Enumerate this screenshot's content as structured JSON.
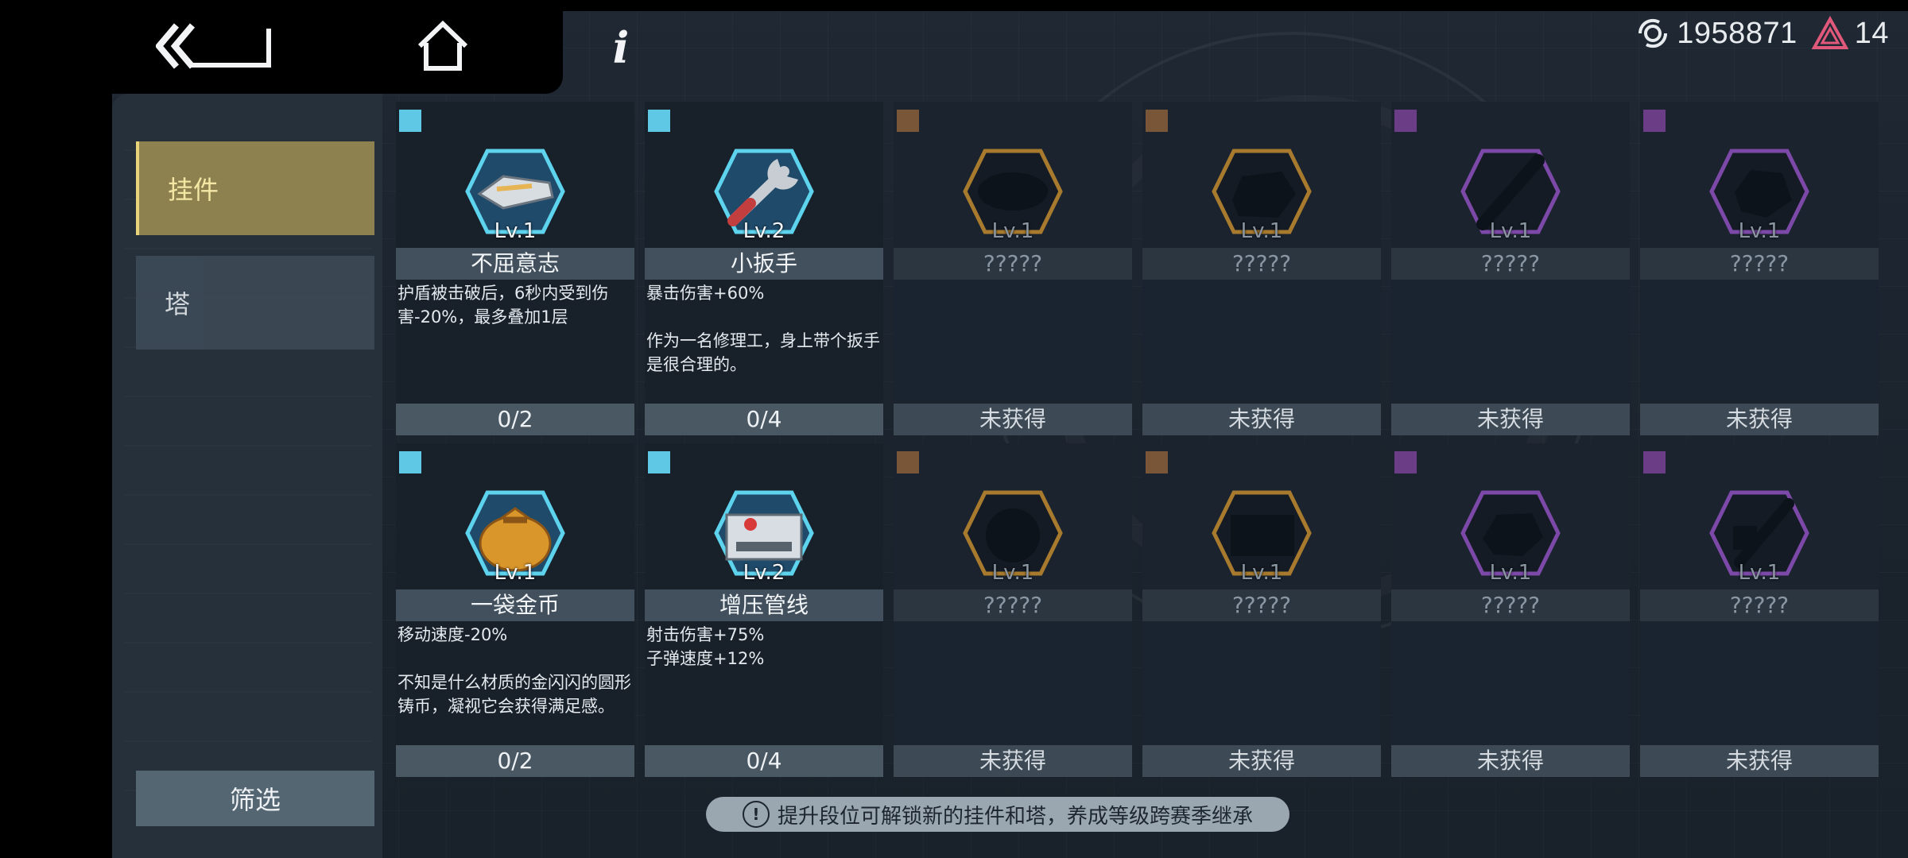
{
  "currency": {
    "credits": "1958871",
    "crystals": "14",
    "credits_icon": "credits-icon",
    "crystal_icon": "crystal-icon"
  },
  "nav": {
    "back_icon": "back-arrow-icon",
    "home_icon": "home-icon",
    "info_icon": "info-icon"
  },
  "sidebar": {
    "tabs": [
      {
        "label": "挂件",
        "active": true
      },
      {
        "label": "塔",
        "active": false
      }
    ],
    "filter_label": "筛选"
  },
  "colors": {
    "rarity_blue": "#5ec8e5",
    "rarity_brown": "#7a5638",
    "rarity_purple": "#6a3d86",
    "active_tab": "#8e8150"
  },
  "items": [
    {
      "level": "Lv.1",
      "name": "不屈意志",
      "desc": "护盾被击破后，6秒内受到伤害-20%，最多叠加1层",
      "count": "0/2",
      "rarity": "blue",
      "icon": "shield-armor-icon"
    },
    {
      "level": "Lv.2",
      "name": "小扳手",
      "desc": "暴击伤害+60%\n\n作为一名修理工，身上带个扳手是很合理的。",
      "count": "0/4",
      "rarity": "blue",
      "icon": "wrench-icon"
    },
    {
      "level": "Lv.1",
      "name": "?????",
      "count": "未获得",
      "rarity": "brown",
      "locked": true
    },
    {
      "level": "Lv.1",
      "name": "?????",
      "count": "未获得",
      "rarity": "brown",
      "locked": true
    },
    {
      "level": "Lv.1",
      "name": "?????",
      "count": "未获得",
      "rarity": "purple",
      "locked": true
    },
    {
      "level": "Lv.1",
      "name": "?????",
      "count": "未获得",
      "rarity": "purple",
      "locked": true
    },
    {
      "level": "Lv.1",
      "name": "一袋金币",
      "desc": "移动速度-20%\n\n不知是什么材质的金闪闪的圆形铸币，凝视它会获得满足感。",
      "count": "0/2",
      "rarity": "blue",
      "icon": "coin-bag-icon"
    },
    {
      "level": "Lv.2",
      "name": "增压管线",
      "desc": "射击伤害+75%\n子弹速度+12%",
      "count": "0/4",
      "rarity": "blue",
      "icon": "pressure-pipe-icon"
    },
    {
      "level": "Lv.1",
      "name": "?????",
      "count": "未获得",
      "rarity": "brown",
      "locked": true
    },
    {
      "level": "Lv.1",
      "name": "?????",
      "count": "未获得",
      "rarity": "brown",
      "locked": true
    },
    {
      "level": "Lv.1",
      "name": "?????",
      "count": "未获得",
      "rarity": "purple",
      "locked": true
    },
    {
      "level": "Lv.1",
      "name": "?????",
      "count": "未获得",
      "rarity": "purple",
      "locked": true
    }
  ],
  "hint": "提升段位可解锁新的挂件和塔，养成等级跨赛季继承"
}
